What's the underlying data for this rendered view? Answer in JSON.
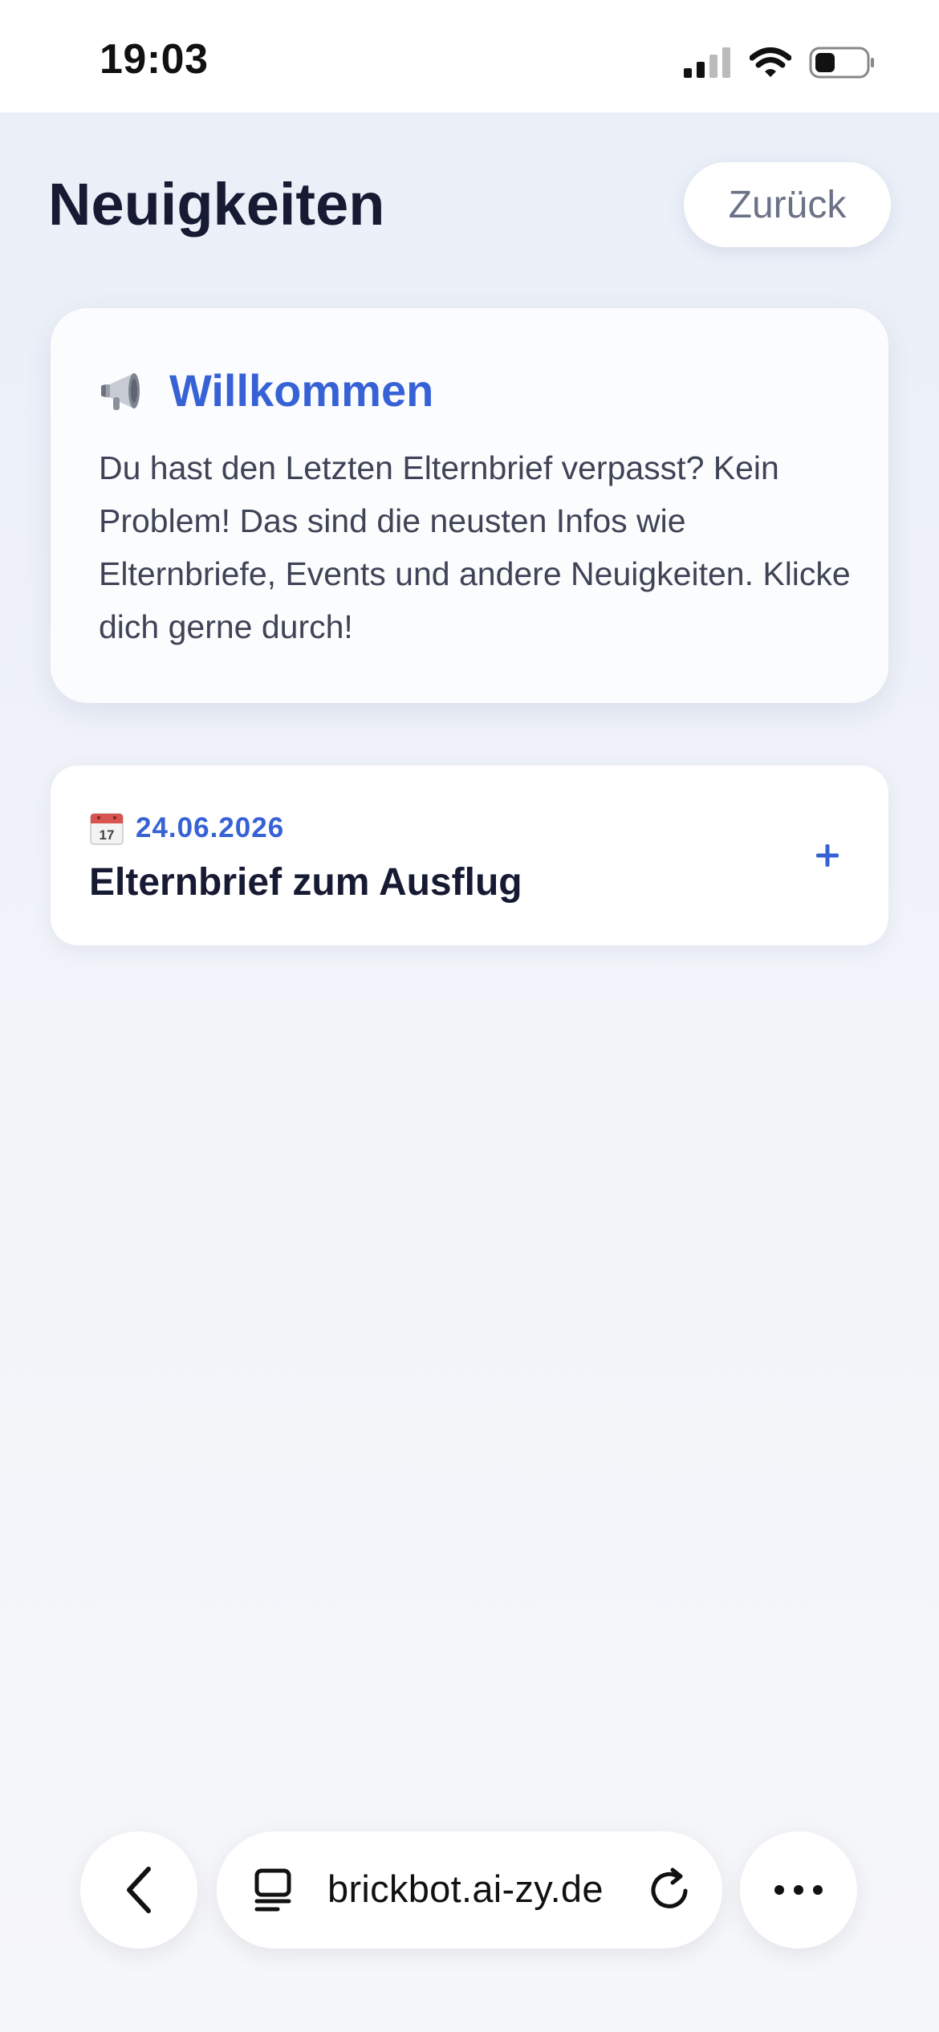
{
  "status_bar": {
    "time": "19:03",
    "icons": [
      "cellular-signal-icon",
      "wifi-icon",
      "battery-icon"
    ]
  },
  "header": {
    "title": "Neuigkeiten",
    "back_label": "Zurück"
  },
  "welcome": {
    "icon": "megaphone-icon",
    "title": "Willkommen",
    "text": "Du hast den Letzten Elternbrief verpasst? Kein Problem! Das sind die neusten Infos wie Elternbriefe, Events und andere Neuigkeiten. Klicke dich gerne durch!"
  },
  "news_items": [
    {
      "icon": "calendar-icon",
      "date": "24.06.2026",
      "title": "Elternbrief zum Ausflug",
      "expand_label": "+"
    }
  ],
  "browser": {
    "url": "brickbot.ai-zy.de",
    "icons": [
      "back-chevron-icon",
      "tabs-icon",
      "reload-icon",
      "more-icon"
    ]
  },
  "colors": {
    "accent": "#3762d6",
    "title": "#161b33",
    "body_text": "#3e4456",
    "muted": "#6b7286",
    "background": "#eef1f8"
  }
}
